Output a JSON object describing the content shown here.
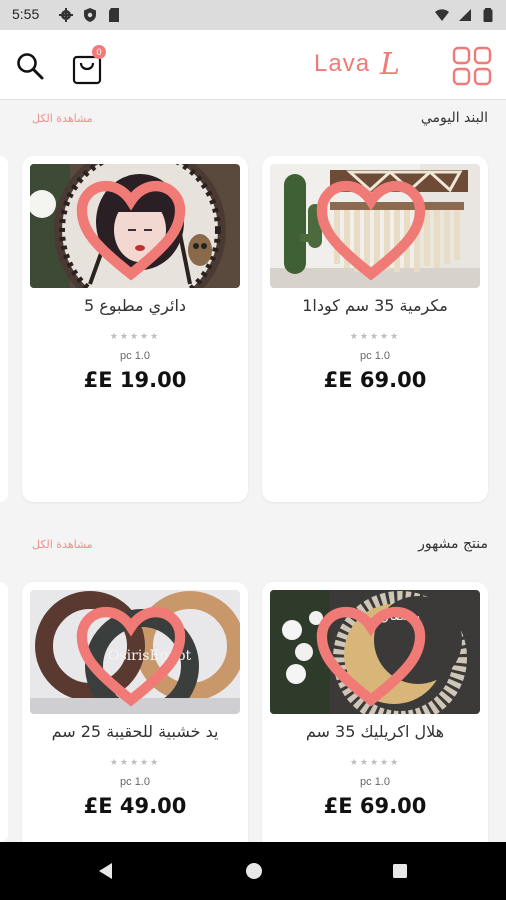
{
  "status_bar": {
    "time": "5:55",
    "icons_left": [
      "settings-icon",
      "shield-icon",
      "sd-card-icon"
    ],
    "icons_right": [
      "wifi-icon",
      "signal-icon",
      "battery-icon"
    ]
  },
  "header": {
    "cart_count": "0",
    "brand_text": "Lava",
    "brand_mark": "L",
    "accent_color": "#f07a76"
  },
  "sections": [
    {
      "title": "البند اليومي",
      "view_all": "مشاهدة الكل",
      "products": [
        {
          "name": "مكرمية  35 سم كودا1",
          "rating_stars": "★★★★★",
          "unit": "pc 1.0",
          "price": "£E 69.00",
          "image": "macrame-wall-hanging"
        },
        {
          "name": "دائري مطبوع 5",
          "rating_stars": "★★★★★",
          "unit": "pc 1.0",
          "price": "£E 19.00",
          "image": "round-printed-portrait"
        }
      ]
    },
    {
      "title": "منتج مشهور",
      "view_all": "مشاهدة الكل",
      "products": [
        {
          "name": "هلال اكريليك 35 سم",
          "rating_stars": "★★★★★",
          "unit": "pc 1.0",
          "price": "£E 69.00",
          "image": "acrylic-crescent"
        },
        {
          "name": "يد خشبية للحقيبة  25 سم",
          "rating_stars": "★★★★★",
          "unit": "pc 1.0",
          "price": "£E 49.00",
          "image": "wooden-bag-handles",
          "watermark": "OsirisEgypt"
        }
      ]
    }
  ]
}
